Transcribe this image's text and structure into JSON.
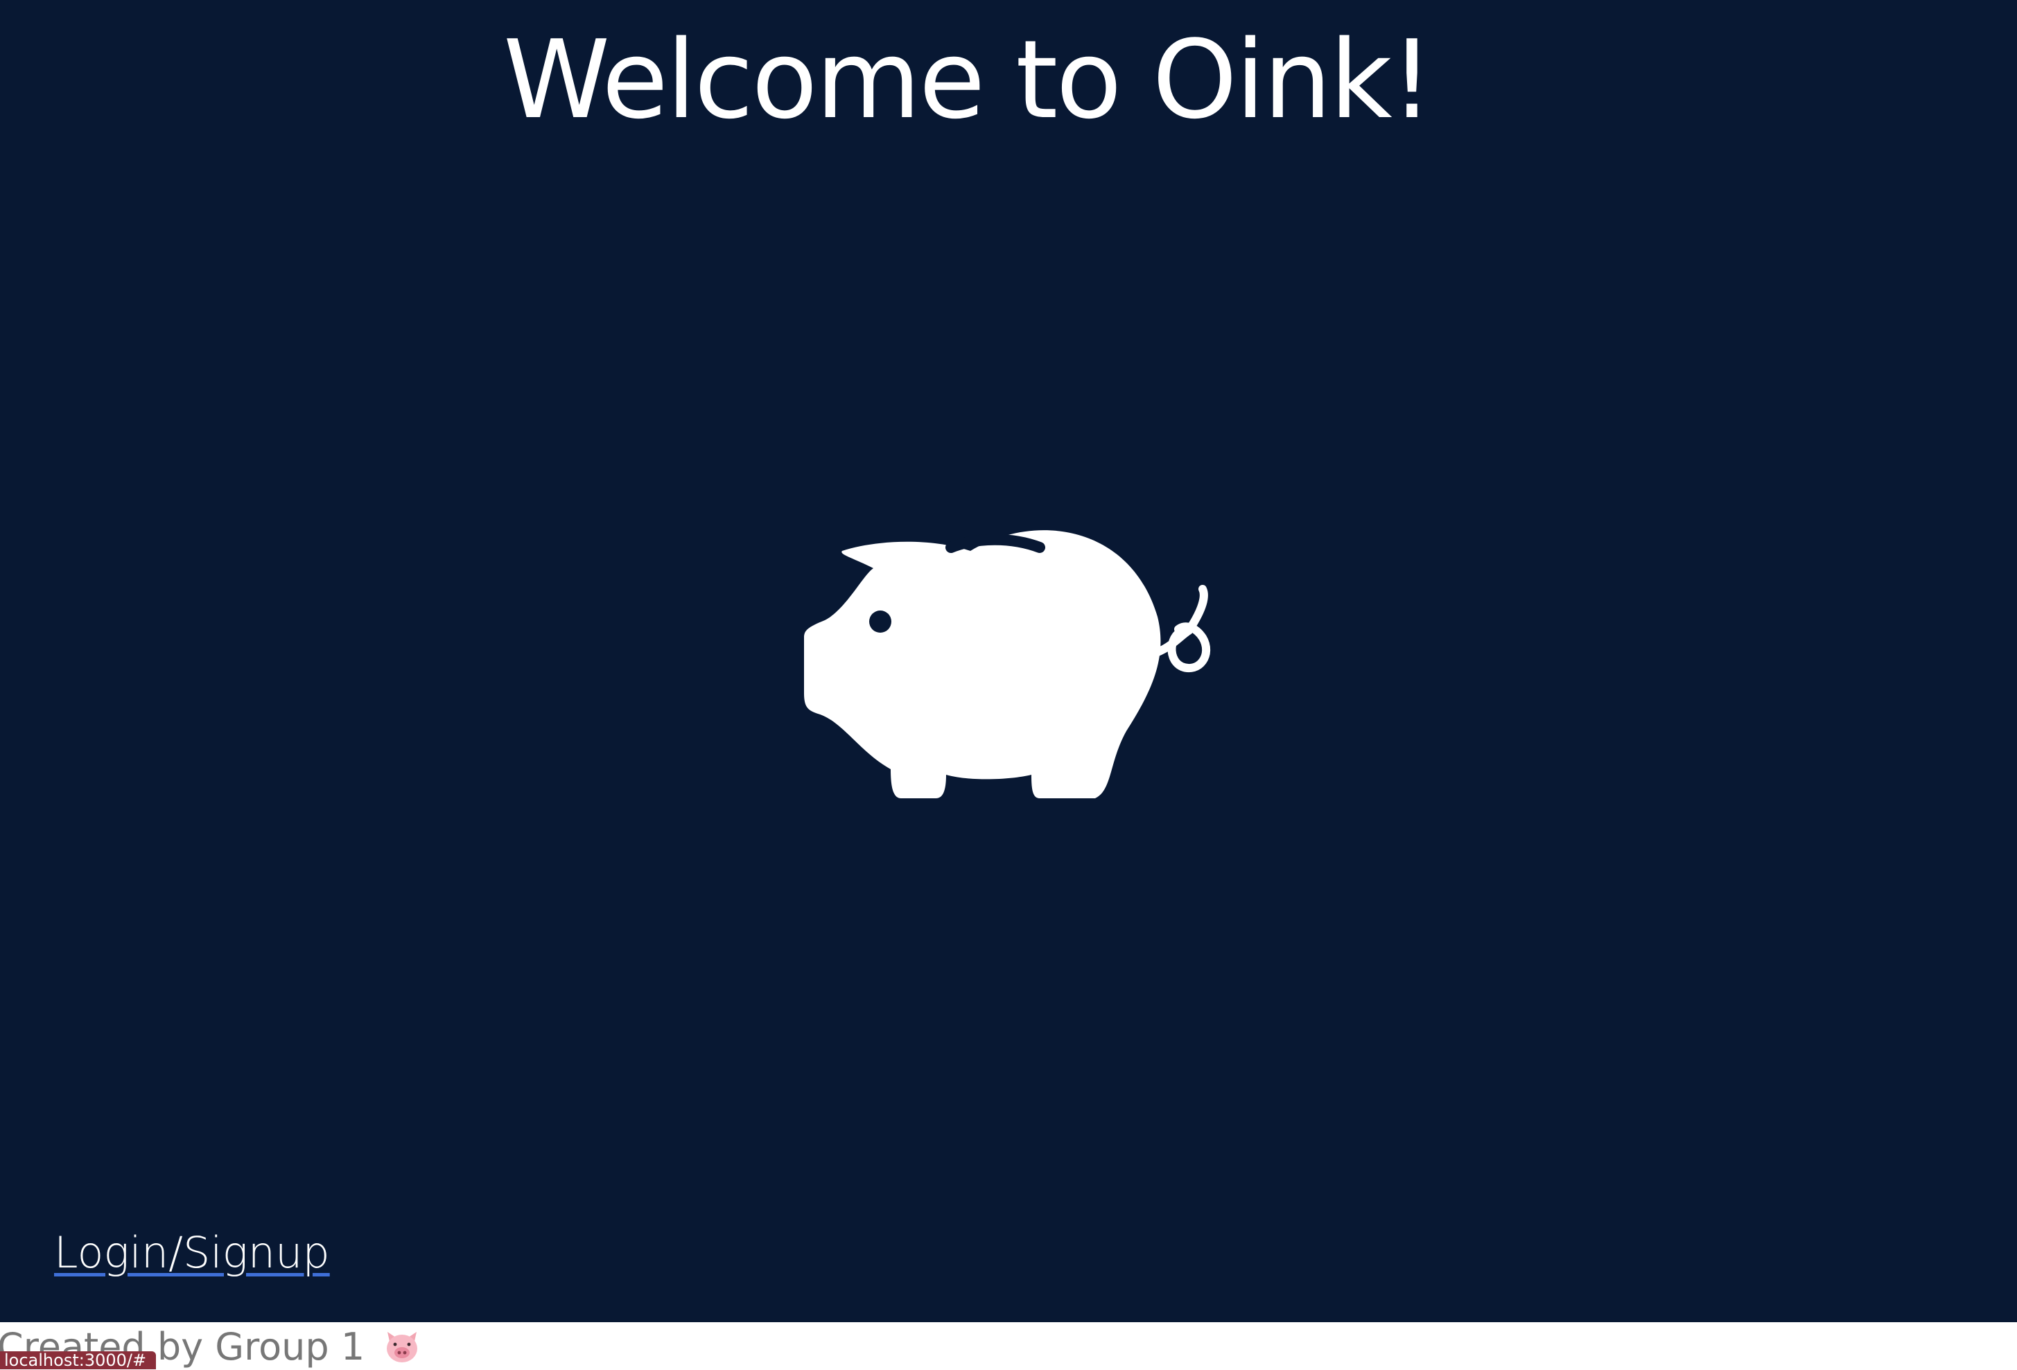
{
  "header": {
    "title": "Welcome to Oink!"
  },
  "hero": {
    "icon": "piggy-bank-icon",
    "background_color": "#081833",
    "icon_color": "#ffffff"
  },
  "actions": {
    "login_label": "Login/Signup",
    "link_underline_color": "#3f6fd8"
  },
  "footer": {
    "credit": "Created by Group 1",
    "emoji_icon": "pig-face-icon"
  },
  "browser": {
    "status_url": "localhost:3000/#"
  }
}
